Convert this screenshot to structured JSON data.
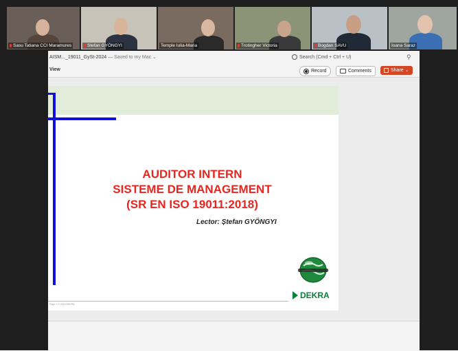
{
  "participants": [
    {
      "name": "Sasu Tatiana CCI Maramures",
      "muted": true,
      "bg": "#6a5f58",
      "skin": "#d7b39b",
      "shirt": "#55453c"
    },
    {
      "name": "Stefan GYÖNGYI",
      "muted": true,
      "bg": "#c8c3b8",
      "skin": "#d8b49a",
      "shirt": "#2b3340"
    },
    {
      "name": "Temple Iulia-Maria",
      "muted": false,
      "bg": "#7a6b60",
      "skin": "#d9b8a2",
      "shirt": "#2a2a2a"
    },
    {
      "name": "Trotingher Victoria",
      "muted": true,
      "bg": "#8c9478",
      "skin": "#c9a48d",
      "shirt": "#3a3a3a"
    },
    {
      "name": "Bogdan SAVU",
      "muted": true,
      "bg": "#b9c0c6",
      "skin": "#c79d83",
      "shirt": "#1f2a36"
    },
    {
      "name": "Ioana Saraz",
      "muted": false,
      "bg": "#9fa6a0",
      "skin": "#e2c3ad",
      "shirt": "#3b6fb3"
    }
  ],
  "window": {
    "doc_title": "AISM..._19011_GySt-2024",
    "saved_status": " — Saved to my Mac ⌄",
    "search_placeholder": "Search (Cmd + Ctrl + U)",
    "view_tab": "View",
    "record_label": "Record",
    "comments_label": "Comments",
    "share_label": "Share ⌄"
  },
  "slide": {
    "title_lines": [
      "AUDITOR INTERN",
      "SISTEME DE MANAGEMENT",
      "(SR EN ISO 19011:2018)"
    ],
    "lector": "Lector: Ștefan GYÖNGYI",
    "logo_text": "DEKRA",
    "footer_text": "Page 1 © 2019 DEKRA",
    "accent_color": "#e8251e",
    "band_color": "#e1ecd9",
    "brand_color": "#0b7f3a"
  }
}
